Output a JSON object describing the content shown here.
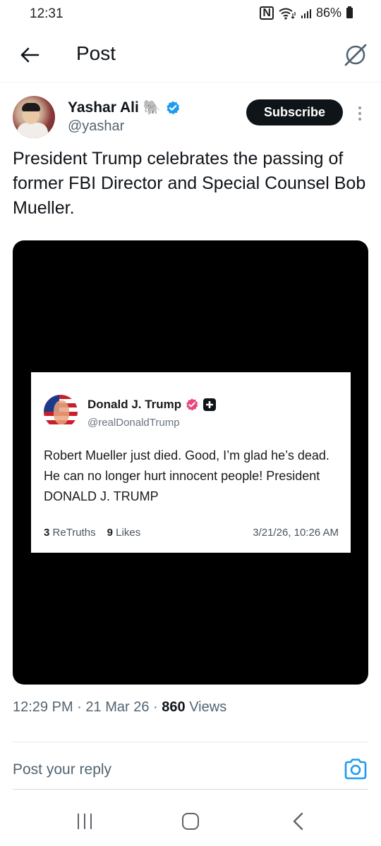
{
  "status_bar": {
    "time": "12:31",
    "nfc": "N",
    "battery": "86%"
  },
  "header": {
    "title": "Post",
    "back_icon": "arrow-left-icon",
    "grok_icon": "grok-slash-circle-icon"
  },
  "post": {
    "author": {
      "name": "Yashar Ali",
      "emoji": "🐘",
      "handle": "@yashar",
      "verified": true
    },
    "subscribe_label": "Subscribe",
    "text": "President Trump celebrates the passing of former FBI Director and Special Counsel Bob Mueller.",
    "embedded": {
      "name": "Donald J. Trump",
      "handle": "@realDonaldTrump",
      "text": "Robert Mueller just died. Good, I’m glad he’s dead. He can no longer hurt innocent people! President DONALD J. TRUMP",
      "retruths_count": "3",
      "retruths_label": "ReTruths",
      "likes_count": "9",
      "likes_label": "Likes",
      "timestamp": "3/21/26, 10:26 AM"
    },
    "meta": {
      "time": "12:29 PM",
      "separator": "·",
      "date": "21 Mar 26",
      "views_count": "860",
      "views_label": "Views"
    }
  },
  "reply": {
    "placeholder": "Post your reply",
    "camera_icon": "camera-icon"
  },
  "colors": {
    "verified_blue": "#1d9bf0",
    "truth_badge_pink": "#e8477e",
    "text_secondary": "#536471",
    "camera_blue": "#1d9bf0"
  },
  "nav": {
    "recents_icon": "recents-icon",
    "home_icon": "home-icon",
    "back_icon": "back-chevron-icon"
  }
}
